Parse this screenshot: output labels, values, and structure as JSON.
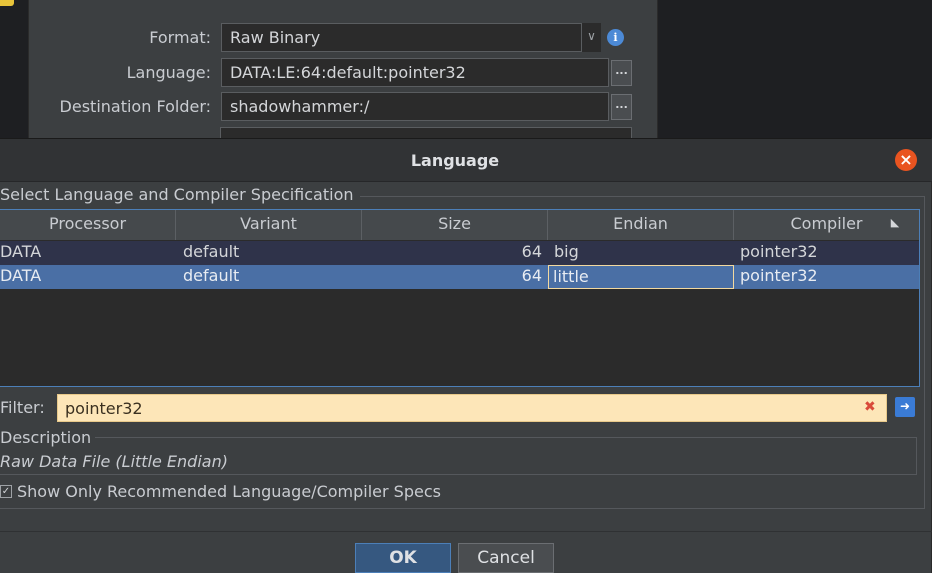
{
  "background_dialog": {
    "format_label": "Format:",
    "format_value": "Raw Binary",
    "language_label": "Language:",
    "language_value": "DATA:LE:64:default:pointer32",
    "destination_label": "Destination Folder:",
    "destination_value": "shadowhammer:/",
    "browse_label": "..."
  },
  "dialog": {
    "title": "Language",
    "group_title": "Select Language and Compiler Specification",
    "columns": [
      "Processor",
      "Variant",
      "Size",
      "Endian",
      "Compiler"
    ],
    "rows": [
      {
        "processor": "DATA",
        "variant": "default",
        "size": "64",
        "endian": "big",
        "compiler": "pointer32",
        "selected": false
      },
      {
        "processor": "DATA",
        "variant": "default",
        "size": "64",
        "endian": "little",
        "compiler": "pointer32",
        "selected": true
      }
    ],
    "filter_label": "Filter:",
    "filter_value": "pointer32",
    "description_title": "Description",
    "description_text": "Raw Data File (Little Endian)",
    "checkbox_label": "Show Only Recommended Language/Compiler Specs",
    "checkbox_checked": true,
    "ok_label": "OK",
    "cancel_label": "Cancel"
  },
  "colors": {
    "selection": "#4a6fa5",
    "filter_bg": "#fde6b8",
    "close_button": "#e95420",
    "ok_button": "#365880"
  }
}
